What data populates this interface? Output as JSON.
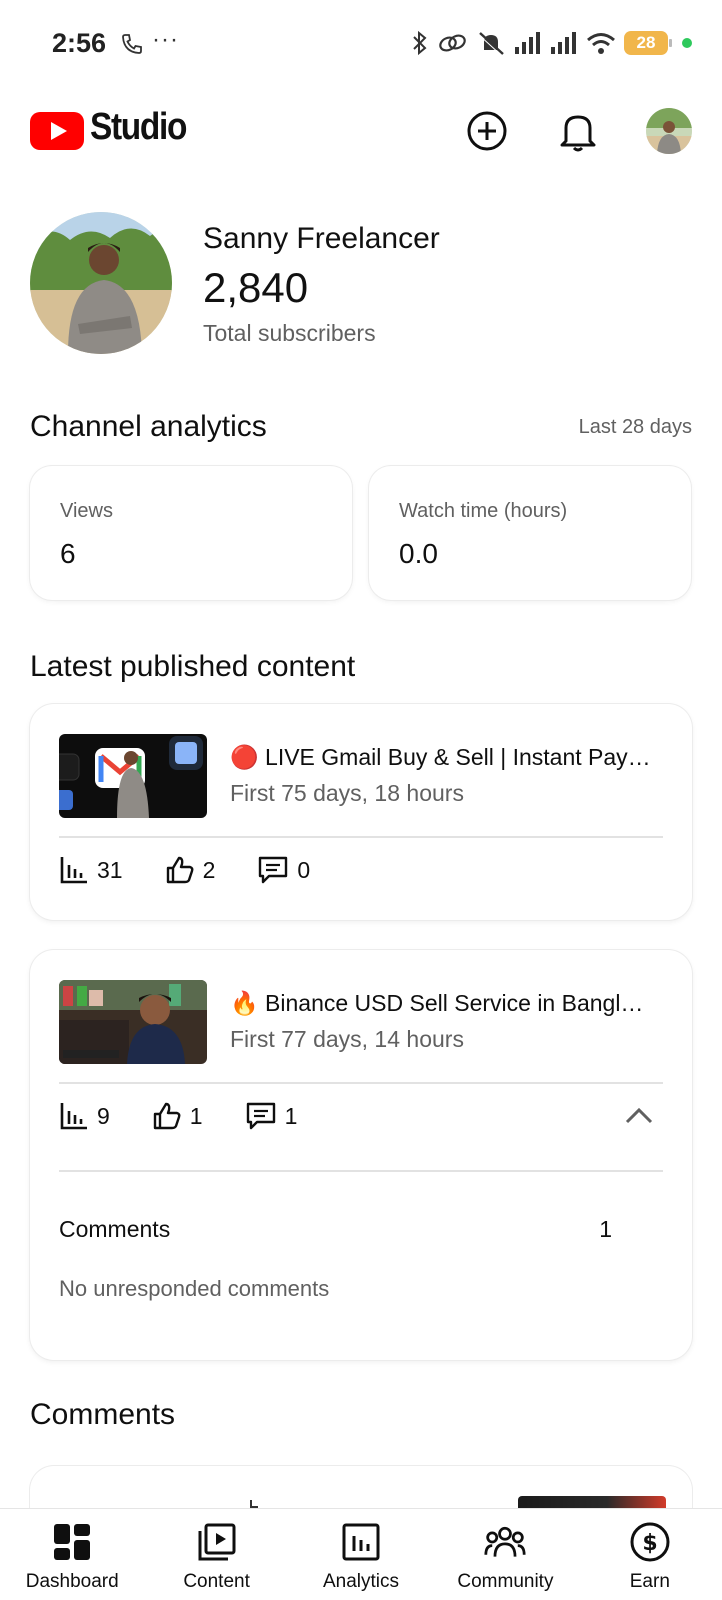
{
  "status_bar": {
    "time": "2:56",
    "dots": "···",
    "battery_level": "28"
  },
  "header": {
    "studio_label": "Studio",
    "icons": [
      "youtube-logo-icon",
      "create-plus-icon",
      "bell-icon",
      "avatar"
    ]
  },
  "channel": {
    "name": "Sanny Freelancer",
    "subscribers": "2,840",
    "subscribers_label": "Total subscribers"
  },
  "analytics": {
    "title": "Channel analytics",
    "range": "Last 28 days",
    "cards": [
      {
        "label": "Views",
        "value": "6"
      },
      {
        "label": "Watch time (hours)",
        "value": "0.0"
      }
    ]
  },
  "latest": {
    "title": "Latest published content",
    "items": [
      {
        "emoji": "🔴",
        "title": "LIVE Gmail Buy & Sell | Instant Pay…",
        "subtitle": "First 75 days, 18 hours",
        "views": "31",
        "likes": "2",
        "comments": "0"
      },
      {
        "emoji": "🔥",
        "title": "Binance USD Sell Service in Bangl…",
        "subtitle": "First 77 days, 14 hours",
        "views": "9",
        "likes": "1",
        "comments": "1",
        "expanded": {
          "comments_label": "Comments",
          "comments_count": "1",
          "no_unresponded": "No unresponded comments"
        }
      }
    ]
  },
  "comments_section": {
    "title": "Comments"
  },
  "bottom_nav": {
    "items": [
      {
        "label": "Dashboard",
        "icon": "dashboard-icon"
      },
      {
        "label": "Content",
        "icon": "content-icon"
      },
      {
        "label": "Analytics",
        "icon": "analytics-icon"
      },
      {
        "label": "Community",
        "icon": "community-icon"
      },
      {
        "label": "Earn",
        "icon": "earn-dollar-icon"
      }
    ]
  },
  "colors": {
    "youtube_red": "#ff0000",
    "text_primary": "#0f0f0f",
    "text_secondary": "#606060",
    "battery": "#f1b64b"
  }
}
